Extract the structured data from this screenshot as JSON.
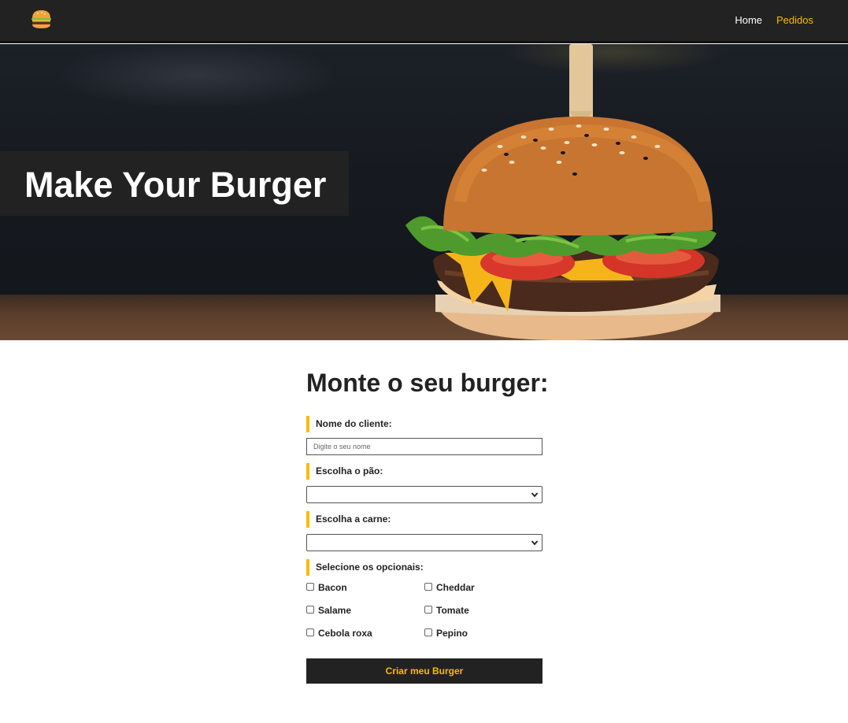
{
  "nav": {
    "logo_icon": "burger-logo-icon",
    "links": [
      {
        "label": "Home",
        "color": "#ffffff"
      },
      {
        "label": "Pedidos",
        "color": "#fcba03"
      }
    ]
  },
  "hero": {
    "title": "Make Your Burger",
    "image_icon": "burger-photo"
  },
  "form": {
    "title": "Monte o seu burger:",
    "name_label": "Nome do cliente:",
    "name_placeholder": "Digite o seu nome",
    "name_value": "",
    "bread_label": "Escolha o pão:",
    "bread_value": "",
    "meat_label": "Escolha a carne:",
    "meat_value": "",
    "optionals_label": "Selecione os opcionais:",
    "optionals": [
      {
        "label": "Bacon",
        "checked": false
      },
      {
        "label": "Cheddar",
        "checked": false
      },
      {
        "label": "Salame",
        "checked": false
      },
      {
        "label": "Tomate",
        "checked": false
      },
      {
        "label": "Cebola roxa",
        "checked": false
      },
      {
        "label": "Pepino",
        "checked": false
      }
    ],
    "submit_label": "Criar meu Burger"
  },
  "colors": {
    "dark": "#222222",
    "accent": "#fcba03",
    "white": "#ffffff"
  }
}
